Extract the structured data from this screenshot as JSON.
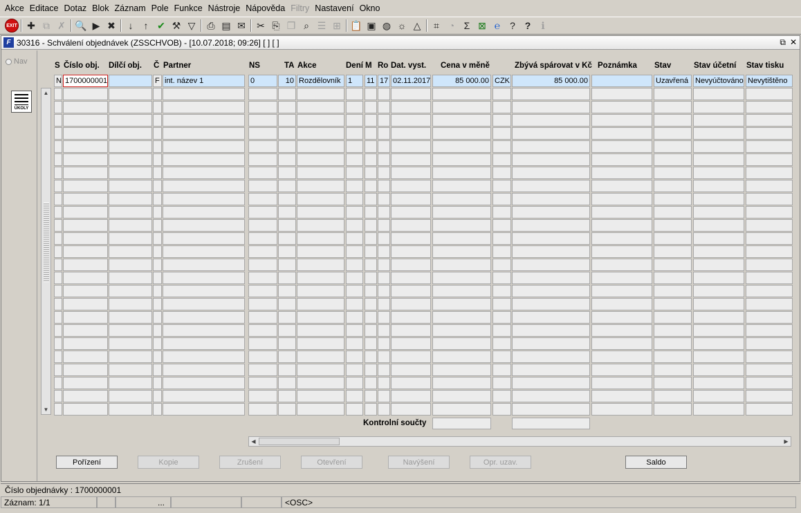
{
  "menu": [
    "Akce",
    "Editace",
    "Dotaz",
    "Blok",
    "Záznam",
    "Pole",
    "Funkce",
    "Nástroje",
    "Nápověda",
    "Filtry",
    "Nastavení",
    "Okno"
  ],
  "menu_disabled": [
    "Filtry"
  ],
  "window": {
    "title": "30316 - Schválení objednávek (ZSSCHVOB) - [10.07.2018; 09:26]  [ ]  [ ]"
  },
  "nav_label": "Nav",
  "ukoly_label": "ÚKOLY",
  "exit_label": "EXIT",
  "columns": {
    "s": "S",
    "cislo": "Číslo obj.",
    "dilci": "Dílčí obj.",
    "c": "Č",
    "partner": "Partner",
    "ns": "NS",
    "ta": "TA",
    "akce": "Akce",
    "deni": "Dení",
    "m": "M",
    "ro": "Ro",
    "dat": "Dat. vyst.",
    "cena": "Cena v měně",
    "zbyva": "Zbývá spárovat v Kč",
    "pozn": "Poznámka",
    "stav": "Stav",
    "stav_ucetni": "Stav účetní",
    "stav_tisku": "Stav tisku"
  },
  "row1": {
    "s": "N",
    "cislo": "1700000001",
    "dilci": "",
    "c": "F",
    "partner": "int. název 1",
    "ns": "0",
    "ta": "10",
    "akce": "Rozdělovník",
    "deni": "1",
    "m": "11",
    "ro": "17",
    "dat": "02.11.2017",
    "cena": "85 000.00",
    "mena": "CZK",
    "zbyva": "85 000.00",
    "pozn": "",
    "stav": "Uzavřená",
    "stav_ucetni": "Nevyúčtováno",
    "stav_tisku": "Nevytištěno"
  },
  "sum_label": "Kontrolní součty",
  "buttons": {
    "porizeni": "Pořízení",
    "kopie": "Kopie",
    "zruseni": "Zrušení",
    "otevreni": "Otevření",
    "navyseni": "Navýšení",
    "opr_uzav": "Opr. uzav.",
    "saldo": "Saldo"
  },
  "status": {
    "line1": "Číslo objednávky : 1700000001",
    "zaznam": "Záznam: 1/1",
    "dots": "...",
    "osc": "<OSC>"
  }
}
